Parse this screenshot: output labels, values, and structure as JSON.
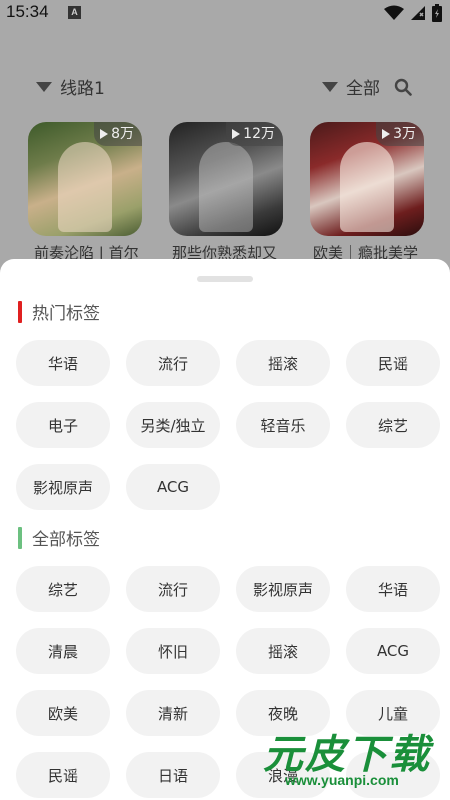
{
  "status_bar": {
    "time": "15:34",
    "notification_letter": "A"
  },
  "filters": {
    "route_label": "线路1",
    "category_label": "全部"
  },
  "playlists": [
    {
      "play_count": "8万",
      "title": "前奏沦陷 | 首尔"
    },
    {
      "play_count": "12万",
      "title": "那些你熟悉却又"
    },
    {
      "play_count": "3万",
      "title": "欧美｜瘾批美学"
    }
  ],
  "sheet": {
    "hot_section": {
      "title": "热门标签",
      "accent": "#e02020",
      "tags": [
        "华语",
        "流行",
        "摇滚",
        "民谣",
        "电子",
        "另类/独立",
        "轻音乐",
        "综艺",
        "影视原声",
        "ACG"
      ]
    },
    "all_section": {
      "title": "全部标签",
      "accent": "#6cc080",
      "tags": [
        "综艺",
        "流行",
        "影视原声",
        "华语",
        "清晨",
        "怀旧",
        "摇滚",
        "ACG",
        "欧美",
        "清新",
        "夜晚",
        "儿童",
        "民谣",
        "日语",
        "浪漫",
        ""
      ]
    }
  },
  "watermark": {
    "logo": "元皮下载",
    "url": "www.yuanpi.com"
  },
  "icons": {
    "wifi": "wifi-icon",
    "signal": "signal-icon",
    "battery": "battery-icon",
    "search": "search-icon",
    "dropdown": "dropdown-triangle-icon",
    "play": "play-icon"
  }
}
